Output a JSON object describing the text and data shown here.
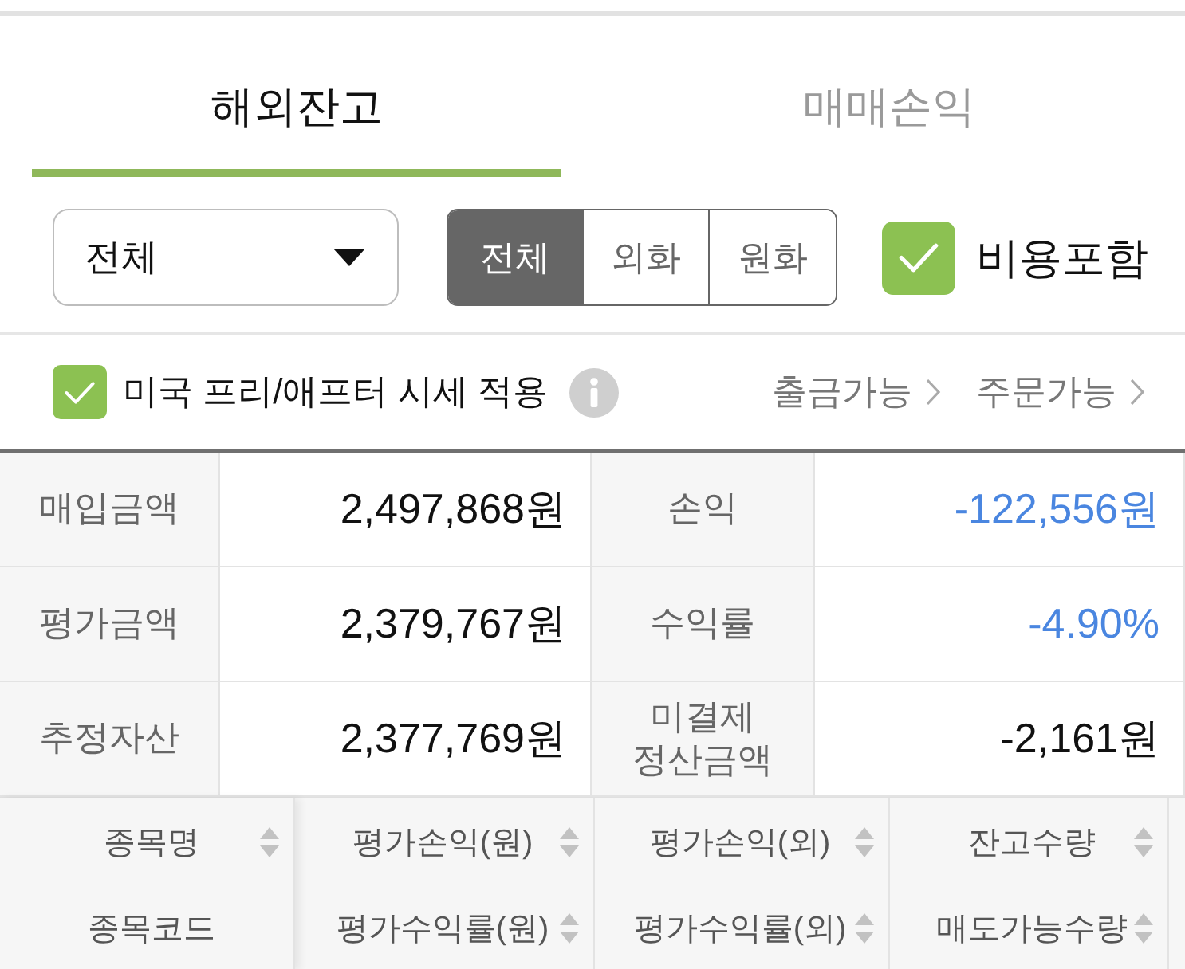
{
  "tabs": [
    {
      "label": "해외잔고",
      "selected": true
    },
    {
      "label": "매매손익",
      "selected": false
    }
  ],
  "filters": {
    "account_dropdown": {
      "value": "전체"
    },
    "currency_toggle": [
      {
        "label": "전체",
        "selected": true
      },
      {
        "label": "외화",
        "selected": false
      },
      {
        "label": "원화",
        "selected": false
      }
    ],
    "include_fees": {
      "label": "비용포함",
      "checked": true
    }
  },
  "options": {
    "extended_hours_price": {
      "label": "미국 프리/애프터 시세 적용",
      "checked": true
    },
    "links": [
      {
        "label": "출금가능"
      },
      {
        "label": "주문가능"
      }
    ]
  },
  "summary": [
    {
      "label": "매입금액",
      "value": "2,497,868원",
      "color": "#111111"
    },
    {
      "label": "손익",
      "value": "-122,556원",
      "color": "#4a86e0"
    },
    {
      "label": "평가금액",
      "value": "2,379,767원",
      "color": "#111111"
    },
    {
      "label": "수익률",
      "value": "-4.90%",
      "color": "#4a86e0"
    },
    {
      "label": "추정자산",
      "value": "2,377,769원",
      "color": "#111111"
    },
    {
      "label": "미결제 정산금액",
      "value": "-2,161원",
      "color": "#111111"
    }
  ],
  "columns": [
    {
      "top": {
        "label": "종목명",
        "sortable": true
      },
      "bottom": {
        "label": "종목코드",
        "sortable": false
      }
    },
    {
      "top": {
        "label": "평가손익(원)",
        "sortable": true
      },
      "bottom": {
        "label": "평가수익률(원)",
        "sortable": true
      }
    },
    {
      "top": {
        "label": "평가손익(외)",
        "sortable": true
      },
      "bottom": {
        "label": "평가수익률(외)",
        "sortable": true
      }
    },
    {
      "top": {
        "label": "잔고수량",
        "sortable": true
      },
      "bottom": {
        "label": "매도가능수량",
        "sortable": true
      }
    }
  ]
}
